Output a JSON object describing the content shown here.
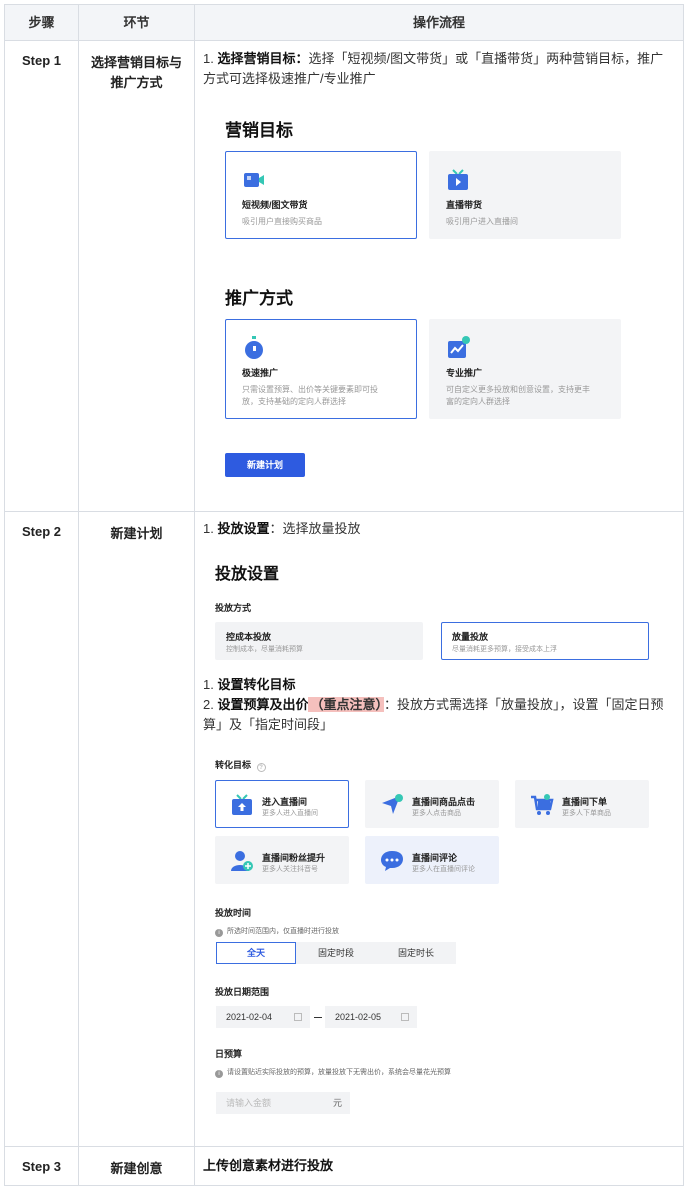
{
  "header": {
    "col1": "步骤",
    "col2": "环节",
    "col3": "操作流程"
  },
  "step1": {
    "step": "Step 1",
    "stage": "选择营销目标与推广方式",
    "li1_num": "1.",
    "li1_bold": "选择营销目标：",
    "li1_text": "选择「短视频/图文带货」或「直播带货」两种营销目标，推广方式可选择极速推广/专业推广",
    "goal_title": "营销目标",
    "goal_cards": [
      {
        "title": "短视频/图文带货",
        "desc": "吸引用户直接购买商品",
        "icon": "video-icon"
      },
      {
        "title": "直播带货",
        "desc": "吸引用户进入直播间",
        "icon": "tv-live-icon"
      }
    ],
    "mode_title": "推广方式",
    "mode_cards": [
      {
        "title": "极速推广",
        "desc": "只需设置预算、出价等关键要素即可投放，支持基础的定向人群选择",
        "icon": "stopwatch-icon"
      },
      {
        "title": "专业推广",
        "desc": "可自定义更多投放和创意设置，支持更丰富的定向人群选择",
        "icon": "trend-chart-icon"
      }
    ],
    "new_plan_button": "新建计划"
  },
  "step2": {
    "step": "Step 2",
    "stage": "新建计划",
    "li1_num": "1.",
    "li1_bold": "投放设置",
    "li1_text": "：选择放量投放",
    "settings_title": "投放设置",
    "method_label": "投放方式",
    "methods": [
      {
        "title": "控成本投放",
        "desc": "控制成本，尽量消耗预算"
      },
      {
        "title": "放量投放",
        "desc": "尽量消耗更多预算，接受成本上浮"
      }
    ],
    "li2_num": "1.",
    "li2_bold": "设置转化目标",
    "li3_num": "2.",
    "li3_bold": "设置预算及出价",
    "li3_highlight": "（重点注意）",
    "li3_text": "：投放方式需选择「放量投放」，设置「固定日预算」及「指定时间段」",
    "conv_label": "转化目标",
    "goals": [
      {
        "title": "进入直播间",
        "desc": "更多人进入直播间",
        "icon": "enter-live-icon"
      },
      {
        "title": "直播间商品点击",
        "desc": "更多人点击商品",
        "icon": "click-arrow-icon"
      },
      {
        "title": "直播间下单",
        "desc": "更多人下单商品",
        "icon": "cart-icon"
      },
      {
        "title": "直播间粉丝提升",
        "desc": "更多人关注抖音号",
        "icon": "add-fan-icon"
      },
      {
        "title": "直播间评论",
        "desc": "更多人在直播间评论",
        "icon": "comment-icon"
      }
    ],
    "time_label": "投放时间",
    "time_note": "所选时间范围内，仅直播时进行投放",
    "time_options": [
      "全天",
      "固定时段",
      "固定时长"
    ],
    "date_label": "投放日期范围",
    "date_start": "2021-02-04",
    "date_end": "2021-02-05",
    "budget_label": "日预算",
    "budget_note": "请设置贴近实际投放的预算，放量投放下无需出价，系统会尽量花光预算",
    "budget_placeholder": "请输入金额",
    "budget_unit": "元"
  },
  "step3": {
    "step": "Step 3",
    "stage": "新建创意",
    "text": "上传创意素材进行投放"
  },
  "colors": {
    "accent": "#2e5be0",
    "highlight": "#f5c0bd",
    "border": "#d9dde3"
  }
}
